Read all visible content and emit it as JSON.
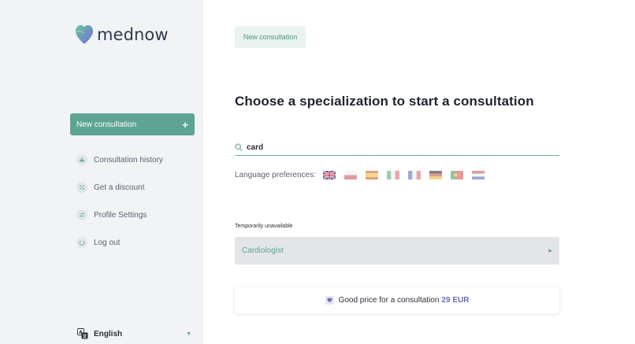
{
  "brand": {
    "name": "mednow"
  },
  "sidebar": {
    "new_button": {
      "label": "New consultation",
      "icon": "plus-icon"
    },
    "items": [
      {
        "label": "Consultation history",
        "icon": "history-icon"
      },
      {
        "label": "Get a discount",
        "icon": "percent-icon"
      },
      {
        "label": "Profile Settings",
        "icon": "settings-icon"
      },
      {
        "label": "Log out",
        "icon": "logout-icon"
      }
    ],
    "language": {
      "label": "English",
      "icon": "translate-icon"
    }
  },
  "main": {
    "tab": "New consultation",
    "title": "Choose a specialization to start a consultation",
    "search": {
      "value": "card",
      "icon": "search-icon"
    },
    "language_preferences": {
      "label": "Language preferences:",
      "flags": [
        "uk-flag",
        "poland-flag",
        "spain-flag",
        "italy-flag",
        "france-flag",
        "germany-flag",
        "portugal-flag",
        "netherlands-flag"
      ]
    },
    "unavailable_label": "Temporarily unavailable",
    "specializations": [
      {
        "label": "Cardiologist"
      }
    ],
    "price_card": {
      "text": "Good price for a consultation",
      "amount": "29 EUR"
    }
  },
  "colors": {
    "accent": "#5fa493",
    "sidebar_bg": "#f2f3f5",
    "price": "#6b6fb8"
  }
}
